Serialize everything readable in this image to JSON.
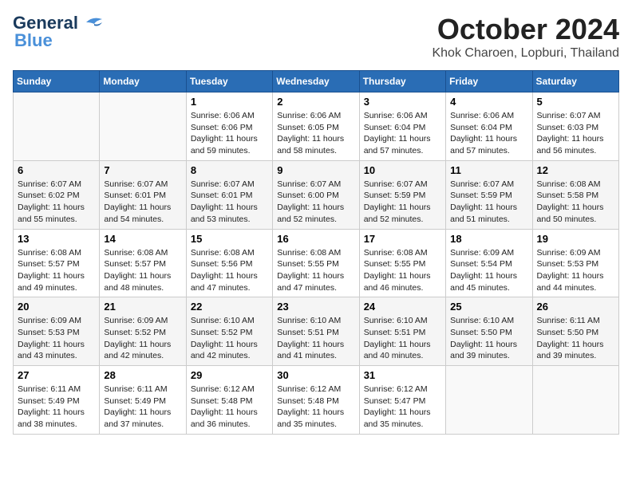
{
  "logo": {
    "part1": "General",
    "part2": "Blue"
  },
  "title": "October 2024",
  "location": "Khok Charoen, Lopburi, Thailand",
  "days_of_week": [
    "Sunday",
    "Monday",
    "Tuesday",
    "Wednesday",
    "Thursday",
    "Friday",
    "Saturday"
  ],
  "weeks": [
    [
      {
        "date": "",
        "info": ""
      },
      {
        "date": "",
        "info": ""
      },
      {
        "date": "1",
        "info": "Sunrise: 6:06 AM\nSunset: 6:06 PM\nDaylight: 11 hours and 59 minutes."
      },
      {
        "date": "2",
        "info": "Sunrise: 6:06 AM\nSunset: 6:05 PM\nDaylight: 11 hours and 58 minutes."
      },
      {
        "date": "3",
        "info": "Sunrise: 6:06 AM\nSunset: 6:04 PM\nDaylight: 11 hours and 57 minutes."
      },
      {
        "date": "4",
        "info": "Sunrise: 6:06 AM\nSunset: 6:04 PM\nDaylight: 11 hours and 57 minutes."
      },
      {
        "date": "5",
        "info": "Sunrise: 6:07 AM\nSunset: 6:03 PM\nDaylight: 11 hours and 56 minutes."
      }
    ],
    [
      {
        "date": "6",
        "info": "Sunrise: 6:07 AM\nSunset: 6:02 PM\nDaylight: 11 hours and 55 minutes."
      },
      {
        "date": "7",
        "info": "Sunrise: 6:07 AM\nSunset: 6:01 PM\nDaylight: 11 hours and 54 minutes."
      },
      {
        "date": "8",
        "info": "Sunrise: 6:07 AM\nSunset: 6:01 PM\nDaylight: 11 hours and 53 minutes."
      },
      {
        "date": "9",
        "info": "Sunrise: 6:07 AM\nSunset: 6:00 PM\nDaylight: 11 hours and 52 minutes."
      },
      {
        "date": "10",
        "info": "Sunrise: 6:07 AM\nSunset: 5:59 PM\nDaylight: 11 hours and 52 minutes."
      },
      {
        "date": "11",
        "info": "Sunrise: 6:07 AM\nSunset: 5:59 PM\nDaylight: 11 hours and 51 minutes."
      },
      {
        "date": "12",
        "info": "Sunrise: 6:08 AM\nSunset: 5:58 PM\nDaylight: 11 hours and 50 minutes."
      }
    ],
    [
      {
        "date": "13",
        "info": "Sunrise: 6:08 AM\nSunset: 5:57 PM\nDaylight: 11 hours and 49 minutes."
      },
      {
        "date": "14",
        "info": "Sunrise: 6:08 AM\nSunset: 5:57 PM\nDaylight: 11 hours and 48 minutes."
      },
      {
        "date": "15",
        "info": "Sunrise: 6:08 AM\nSunset: 5:56 PM\nDaylight: 11 hours and 47 minutes."
      },
      {
        "date": "16",
        "info": "Sunrise: 6:08 AM\nSunset: 5:55 PM\nDaylight: 11 hours and 47 minutes."
      },
      {
        "date": "17",
        "info": "Sunrise: 6:08 AM\nSunset: 5:55 PM\nDaylight: 11 hours and 46 minutes."
      },
      {
        "date": "18",
        "info": "Sunrise: 6:09 AM\nSunset: 5:54 PM\nDaylight: 11 hours and 45 minutes."
      },
      {
        "date": "19",
        "info": "Sunrise: 6:09 AM\nSunset: 5:53 PM\nDaylight: 11 hours and 44 minutes."
      }
    ],
    [
      {
        "date": "20",
        "info": "Sunrise: 6:09 AM\nSunset: 5:53 PM\nDaylight: 11 hours and 43 minutes."
      },
      {
        "date": "21",
        "info": "Sunrise: 6:09 AM\nSunset: 5:52 PM\nDaylight: 11 hours and 42 minutes."
      },
      {
        "date": "22",
        "info": "Sunrise: 6:10 AM\nSunset: 5:52 PM\nDaylight: 11 hours and 42 minutes."
      },
      {
        "date": "23",
        "info": "Sunrise: 6:10 AM\nSunset: 5:51 PM\nDaylight: 11 hours and 41 minutes."
      },
      {
        "date": "24",
        "info": "Sunrise: 6:10 AM\nSunset: 5:51 PM\nDaylight: 11 hours and 40 minutes."
      },
      {
        "date": "25",
        "info": "Sunrise: 6:10 AM\nSunset: 5:50 PM\nDaylight: 11 hours and 39 minutes."
      },
      {
        "date": "26",
        "info": "Sunrise: 6:11 AM\nSunset: 5:50 PM\nDaylight: 11 hours and 39 minutes."
      }
    ],
    [
      {
        "date": "27",
        "info": "Sunrise: 6:11 AM\nSunset: 5:49 PM\nDaylight: 11 hours and 38 minutes."
      },
      {
        "date": "28",
        "info": "Sunrise: 6:11 AM\nSunset: 5:49 PM\nDaylight: 11 hours and 37 minutes."
      },
      {
        "date": "29",
        "info": "Sunrise: 6:12 AM\nSunset: 5:48 PM\nDaylight: 11 hours and 36 minutes."
      },
      {
        "date": "30",
        "info": "Sunrise: 6:12 AM\nSunset: 5:48 PM\nDaylight: 11 hours and 35 minutes."
      },
      {
        "date": "31",
        "info": "Sunrise: 6:12 AM\nSunset: 5:47 PM\nDaylight: 11 hours and 35 minutes."
      },
      {
        "date": "",
        "info": ""
      },
      {
        "date": "",
        "info": ""
      }
    ]
  ]
}
